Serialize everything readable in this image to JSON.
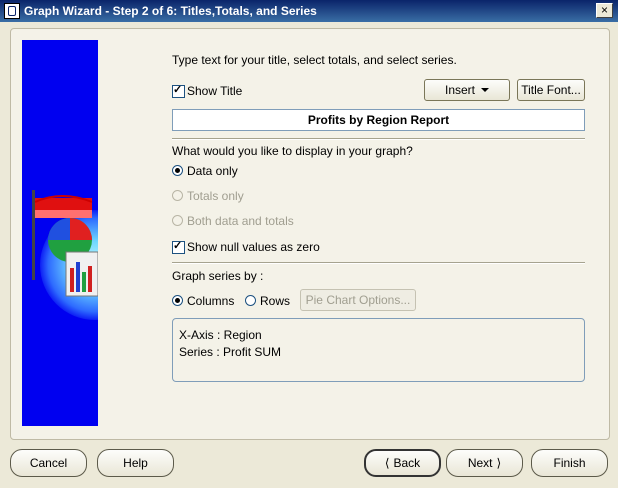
{
  "window": {
    "title": "Graph Wizard - Step 2 of 6: Titles,Totals, and Series",
    "close_label": "×"
  },
  "instructions": "Type text for your title, select totals, and select series.",
  "title_section": {
    "show_title_label": "Show Title",
    "show_title_checked": true,
    "insert_label": "Insert",
    "title_font_label": "Title Font...",
    "title_value": "Profits by Region Report"
  },
  "display_section": {
    "question": "What would you like to display in your graph?",
    "options": [
      {
        "label": "Data only",
        "selected": true,
        "enabled": true
      },
      {
        "label": "Totals only",
        "selected": false,
        "enabled": false
      },
      {
        "label": "Both data and totals",
        "selected": false,
        "enabled": false
      }
    ],
    "null_zero_label": "Show null values as zero",
    "null_zero_checked": true
  },
  "series_section": {
    "label": "Graph series by :",
    "columns_label": "Columns",
    "rows_label": "Rows",
    "selected": "Columns",
    "pie_options_label": "Pie Chart Options..."
  },
  "summary": {
    "line1": "X-Axis  : Region",
    "line2": "Series : Profit SUM"
  },
  "footer": {
    "cancel": "Cancel",
    "help": "Help",
    "back": "Back",
    "next": "Next",
    "finish": "Finish"
  },
  "colors": {
    "sidebar": "#0000f0",
    "titlebar": "#0a246a",
    "dialog": "#ece9d8"
  }
}
